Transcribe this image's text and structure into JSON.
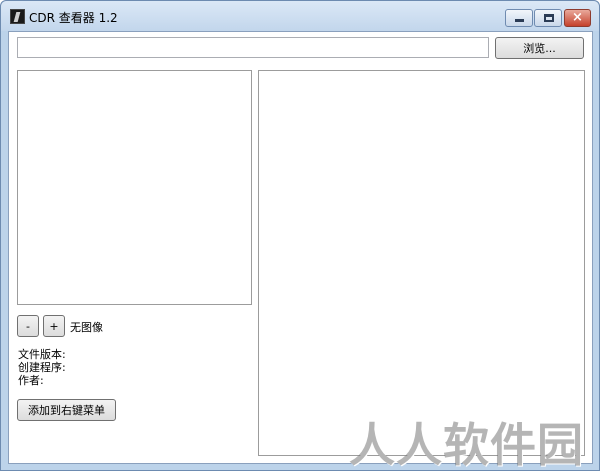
{
  "window": {
    "title": "CDR 查看器 1.2",
    "controls": {
      "minimize": "minimize",
      "maximize": "maximize",
      "close": "×"
    }
  },
  "toolbar": {
    "path_value": "",
    "browse_label": "浏览..."
  },
  "preview": {
    "zoom_out_label": "-",
    "zoom_in_label": "+",
    "status": "无图像"
  },
  "info": {
    "file_version": "文件版本:",
    "creator_app": "创建程序:",
    "author": "作者:"
  },
  "actions": {
    "add_context_menu_label": "添加到右键菜单"
  },
  "watermark": {
    "text": "人人软件园"
  }
}
